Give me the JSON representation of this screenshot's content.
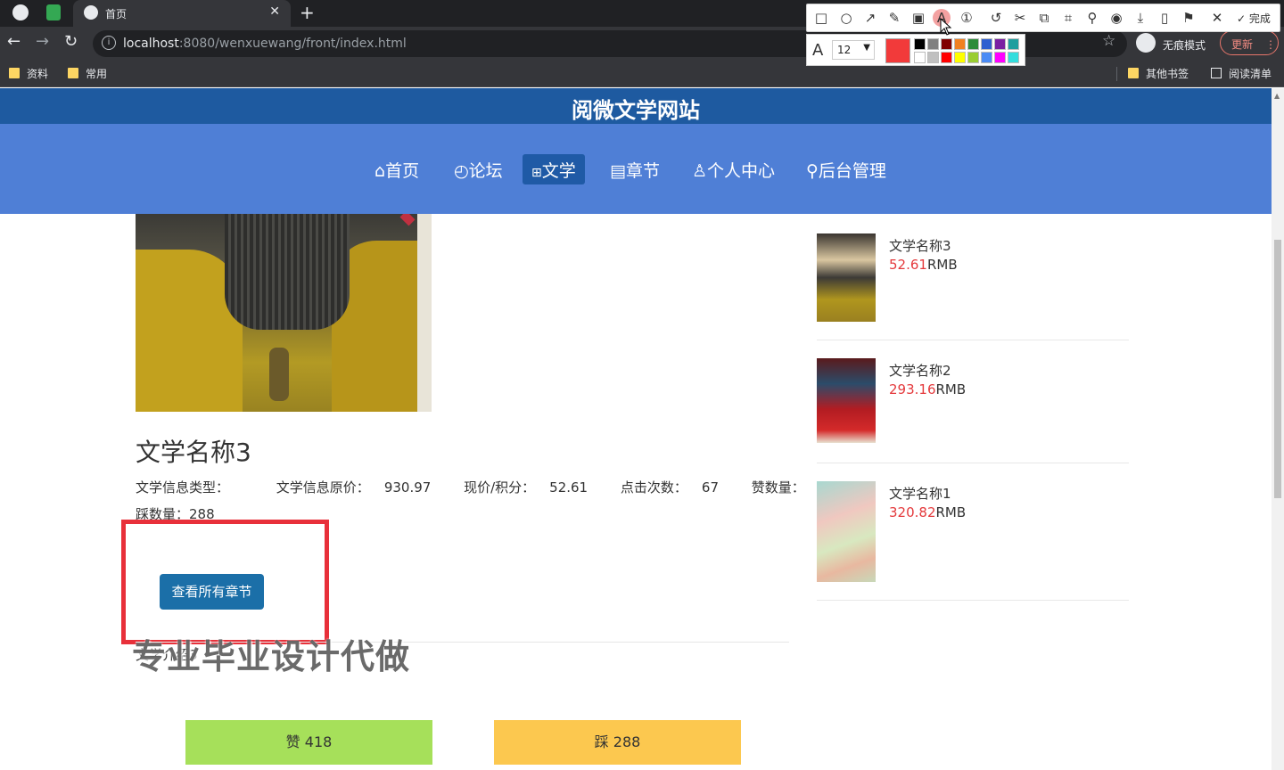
{
  "browser": {
    "tab_title": "首页",
    "url_host": "localhost",
    "url_rest": ":8080/wenxuewang/front/index.html",
    "incognito_label": "无痕模式",
    "update_label": "更新",
    "bookmarks": [
      {
        "label": "资料"
      },
      {
        "label": "常用"
      }
    ],
    "other_bookmarks": "其他书签",
    "reading_list": "阅读清单"
  },
  "screenshot_tool": {
    "done_label": "完成",
    "font_size": "12",
    "current_color": "#f23a3a",
    "palette": [
      "#000000",
      "#808080",
      "#800000",
      "#f08020",
      "#2e8b3a",
      "#2f5fd0",
      "#7a1fa2",
      "#1e9e9e",
      "#ffffff",
      "#c0c0c0",
      "#ff0000",
      "#ffff00",
      "#9acd32",
      "#4b8bf5",
      "#ff00ff",
      "#33dddd"
    ]
  },
  "site": {
    "title": "阅微文学网站",
    "nav": [
      {
        "icon": "⌂",
        "label": "首页"
      },
      {
        "icon": "◴",
        "label": "论坛"
      },
      {
        "icon": "⊞",
        "label": "文学"
      },
      {
        "icon": "▤",
        "label": "章节"
      },
      {
        "icon": "♙",
        "label": "个人中心"
      },
      {
        "icon": "⚲",
        "label": "后台管理"
      }
    ],
    "active_nav": "文学"
  },
  "detail": {
    "title": "文学名称3",
    "type_label": "文学信息类型：",
    "type_value": "",
    "orig_price_label": "文学信息原价：",
    "orig_price": "930.97",
    "cur_price_label": "现价/积分：",
    "cur_price": "52.61",
    "clicks_label": "点击次数：",
    "clicks": "67",
    "likes_label": "赞数量：",
    "likes": "418",
    "dislikes_label": "踩数量：",
    "dislikes": "288",
    "chapters_button": "查看所有章节",
    "intro": "文学介绍3",
    "watermark": "专业毕业设计代做",
    "like_button": "赞  418",
    "dislike_button": "踩  288"
  },
  "sidebar": {
    "items": [
      {
        "name": "文学名称3",
        "price": "52.61",
        "unit": "RMB"
      },
      {
        "name": "文学名称2",
        "price": "293.16",
        "unit": "RMB"
      },
      {
        "name": "文学名称1",
        "price": "320.82",
        "unit": "RMB"
      }
    ]
  }
}
